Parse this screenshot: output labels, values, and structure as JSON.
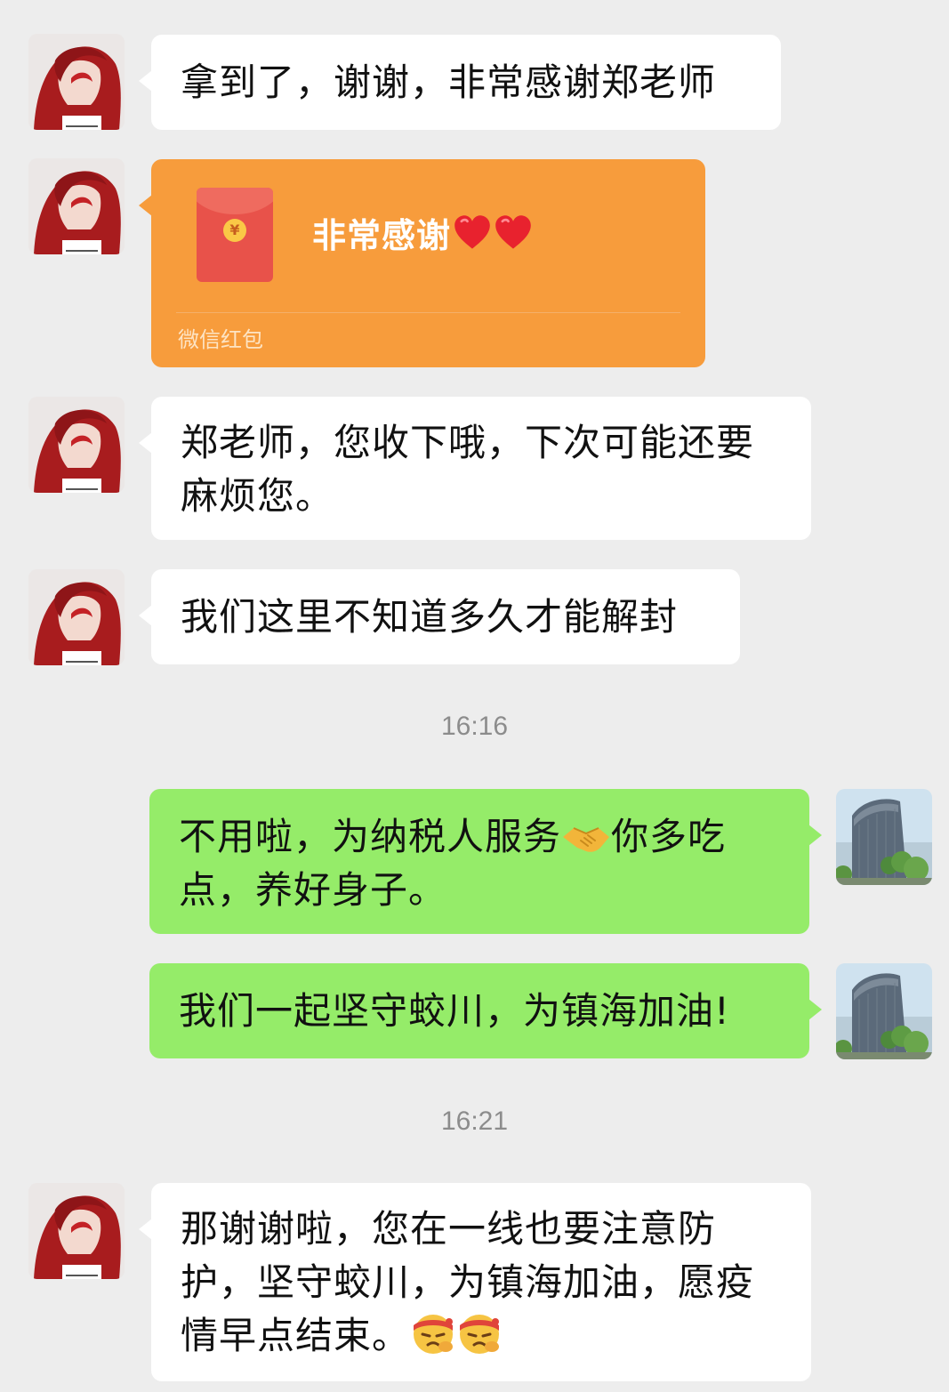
{
  "chat": {
    "messages": [
      {
        "side": "incoming",
        "type": "text",
        "text": "拿到了，谢谢，非常感谢郑老师"
      },
      {
        "side": "incoming",
        "type": "red_packet",
        "message": "非常感谢",
        "icon": "heart-icon",
        "label": "微信红包"
      },
      {
        "side": "incoming",
        "type": "text",
        "text_line1": "郑老师，您收下哦，下次可能还要",
        "text_line2": "麻烦您。"
      },
      {
        "side": "incoming",
        "type": "text",
        "text": "我们这里不知道多久才能解封"
      },
      {
        "type": "timestamp",
        "text": "16:16"
      },
      {
        "side": "outgoing",
        "type": "text",
        "text_part1": "不用啦，为纳税人服务",
        "emoji": "handshake-emoji",
        "text_part2": "你多吃",
        "text_line2": "点，养好身子。"
      },
      {
        "side": "outgoing",
        "type": "text",
        "text": "我们一起坚守蛟川，为镇海加油!"
      },
      {
        "type": "timestamp",
        "text": "16:21"
      },
      {
        "side": "incoming",
        "type": "text",
        "text_line1": "那谢谢啦，您在一线也要注意防",
        "text_line2": "护，坚守蛟川，为镇海加油，愿疫",
        "text_line3": "情早点结束。",
        "emoji": "fighting-face-emoji"
      }
    ]
  },
  "colors": {
    "background": "#ededed",
    "incoming_bubble": "#ffffff",
    "outgoing_bubble": "#95ec69",
    "red_packet": "#f79c3c",
    "timestamp_text": "#8c8c8c"
  },
  "avatars": {
    "contact": "girl-with-red-hair-avatar",
    "self": "building-photo-avatar"
  }
}
